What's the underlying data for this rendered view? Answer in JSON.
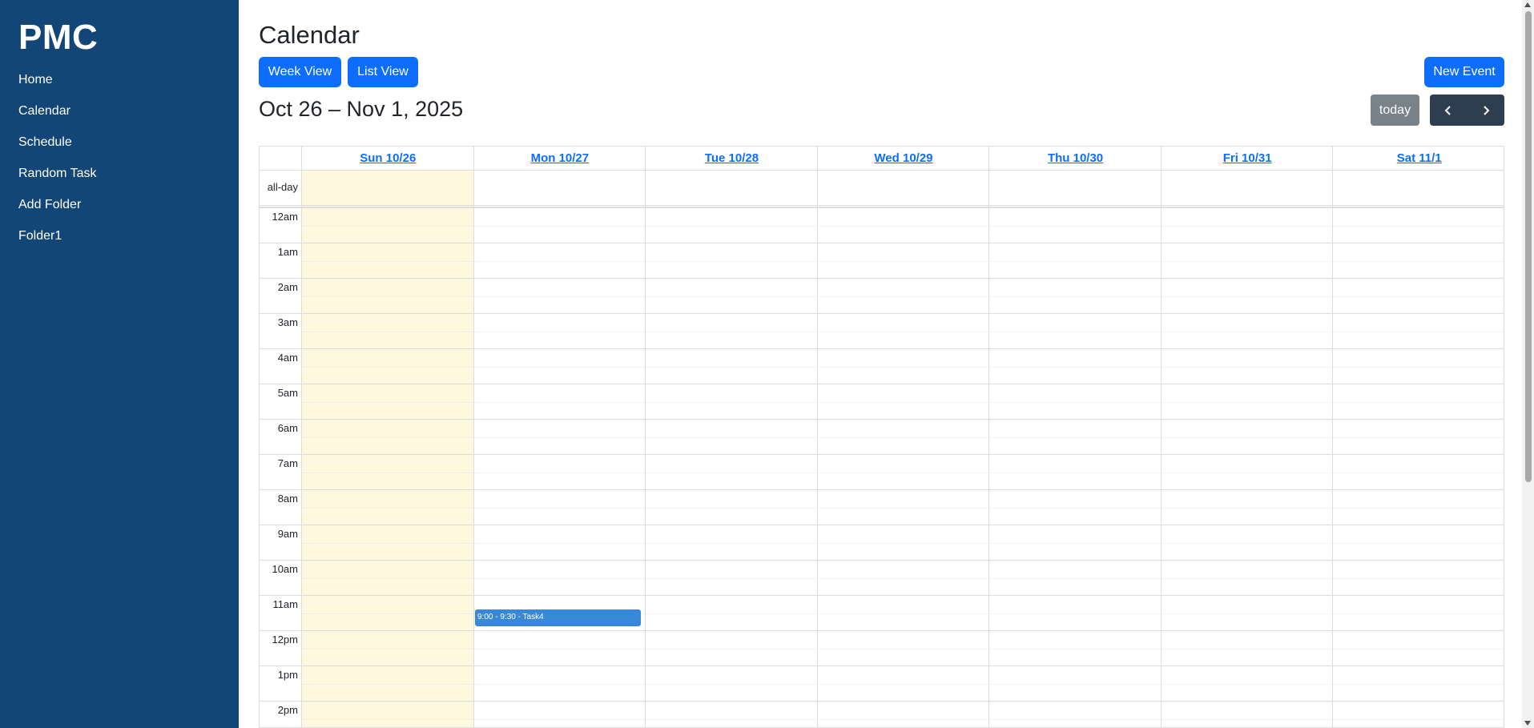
{
  "sidebar": {
    "brand": "PMC",
    "items": [
      {
        "label": "Home"
      },
      {
        "label": "Calendar"
      },
      {
        "label": "Schedule"
      },
      {
        "label": "Random Task"
      },
      {
        "label": "Add Folder"
      },
      {
        "label": "Folder1"
      }
    ]
  },
  "main": {
    "title": "Calendar",
    "week_view_label": "Week View",
    "list_view_label": "List View",
    "new_event_label": "New Event",
    "range_title": "Oct 26 – Nov 1, 2025",
    "today_label": "today"
  },
  "calendar": {
    "allday_label": "all-day",
    "days": [
      "Sun 10/26",
      "Mon 10/27",
      "Tue 10/28",
      "Wed 10/29",
      "Thu 10/30",
      "Fri 10/31",
      "Sat 11/1"
    ],
    "times": [
      "12am",
      "1am",
      "2am",
      "3am",
      "4am",
      "5am",
      "6am",
      "7am",
      "8am",
      "9am",
      "10am",
      "11am",
      "12pm",
      "1pm",
      "2pm"
    ],
    "event": {
      "label": "9:00 - 9:30 - Task4",
      "day": "Mon 10/27"
    },
    "today_highlight_color": "#fef8de",
    "event_color": "#3788d8"
  },
  "colors": {
    "sidebar_bg": "#124676",
    "primary": "#0d6efd",
    "nav_dark": "#2c3e50"
  }
}
